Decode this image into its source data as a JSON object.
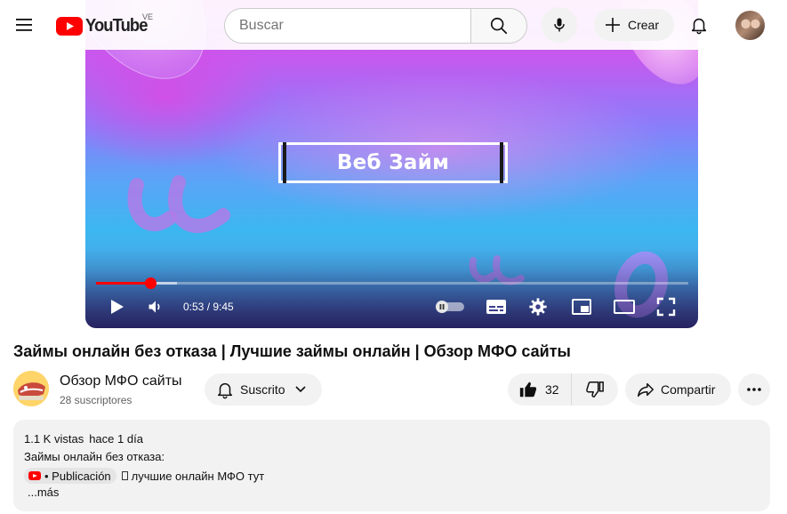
{
  "header": {
    "logo_text": "YouTube",
    "country_code": "VE",
    "search_placeholder": "Buscar",
    "create_label": "Crear"
  },
  "player": {
    "overlay_title": "Веб Займ",
    "current_time": "0:53",
    "duration": "9:45",
    "time_display": "0:53 / 9:45",
    "progress_played_fraction": 0.091,
    "progress_loaded_fraction": 0.136,
    "accent_color": "#ff0000"
  },
  "video": {
    "title": "Займы онлайн без отказа | Лучшие займы онлайн | Обзор МФО сайты"
  },
  "channel": {
    "name": "Обзор МФО сайты",
    "subscribers": "28 suscriptores",
    "subscribe_label": "Suscrito"
  },
  "actions": {
    "like_count": "32",
    "share_label": "Compartir"
  },
  "description": {
    "views": "1.1 K vistas",
    "date": "hace 1 día",
    "line1": "Займы онлайн без отказа:",
    "chip_label": "• Publicación",
    "line2_text": "лучшие онлайн МФО тут",
    "more_label": "...más"
  },
  "icons": {
    "menu": "menu-icon",
    "search": "search-icon",
    "mic": "mic-icon",
    "create": "plus-icon",
    "notifications": "bell-icon",
    "play": "play-icon",
    "volume": "volume-icon",
    "autoplay": "autoplay-toggle-icon",
    "subtitles": "subtitles-icon",
    "settings": "gear-icon",
    "miniplayer": "miniplayer-icon",
    "theater": "theater-mode-icon",
    "fullscreen": "fullscreen-icon",
    "like": "thumbs-up-icon",
    "dislike": "thumbs-down-icon",
    "share": "share-icon",
    "more": "more-horizontal-icon"
  }
}
